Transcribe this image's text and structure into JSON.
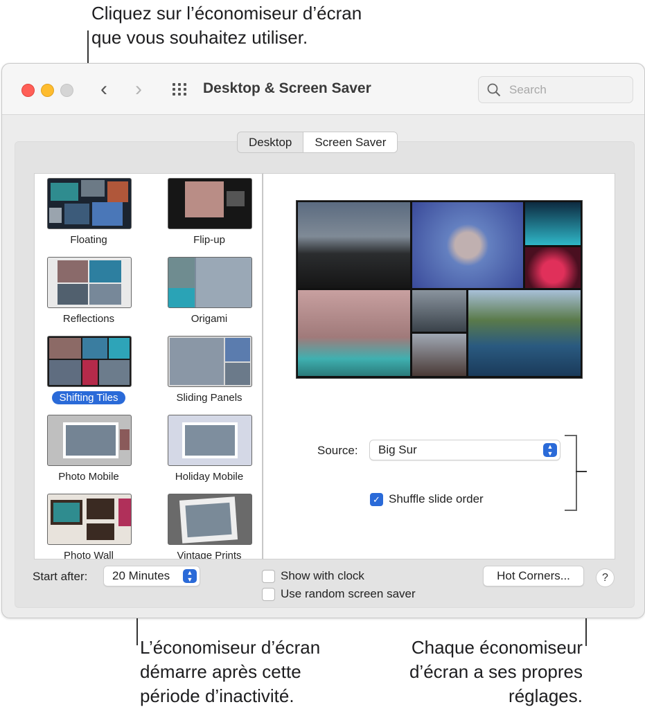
{
  "callouts": {
    "top": "Cliquez sur l’économiseur d’écran\nque vous souhaitez utiliser.",
    "bottom_left": "L’économiseur d’écran\ndémarre après cette\npériode d’inactivité.",
    "bottom_right": "Chaque économiseur\nd’écran a ses propres\nréglages."
  },
  "window": {
    "title": "Desktop & Screen Saver",
    "search_placeholder": "Search",
    "icons": [
      "back-chevron-icon",
      "forward-chevron-icon",
      "grid-icon",
      "search-icon"
    ]
  },
  "tabs": [
    {
      "label": "Desktop",
      "active": false
    },
    {
      "label": "Screen Saver",
      "active": true
    }
  ],
  "savers": [
    {
      "label": "Floating",
      "selected": false
    },
    {
      "label": "Flip-up",
      "selected": false
    },
    {
      "label": "Reflections",
      "selected": false
    },
    {
      "label": "Origami",
      "selected": false
    },
    {
      "label": "Shifting Tiles",
      "selected": true
    },
    {
      "label": "Sliding Panels",
      "selected": false
    },
    {
      "label": "Photo Mobile",
      "selected": false
    },
    {
      "label": "Holiday Mobile",
      "selected": false
    },
    {
      "label": "Photo Wall",
      "selected": false
    },
    {
      "label": "Vintage Prints",
      "selected": false
    }
  ],
  "options": {
    "source_label": "Source:",
    "source_value": "Big Sur",
    "shuffle_label": "Shuffle slide order",
    "shuffle_checked": true
  },
  "footer": {
    "start_after_label": "Start after:",
    "start_after_value": "20 Minutes",
    "show_clock_label": "Show with clock",
    "show_clock_checked": false,
    "random_label": "Use random screen saver",
    "random_checked": false,
    "hot_corners_label": "Hot Corners...",
    "help_label": "?"
  },
  "colors": {
    "accent": "#2a6ad8",
    "close": "#ff5f57",
    "minimize": "#febc2e",
    "zoom_disabled": "#d5d5d5"
  }
}
